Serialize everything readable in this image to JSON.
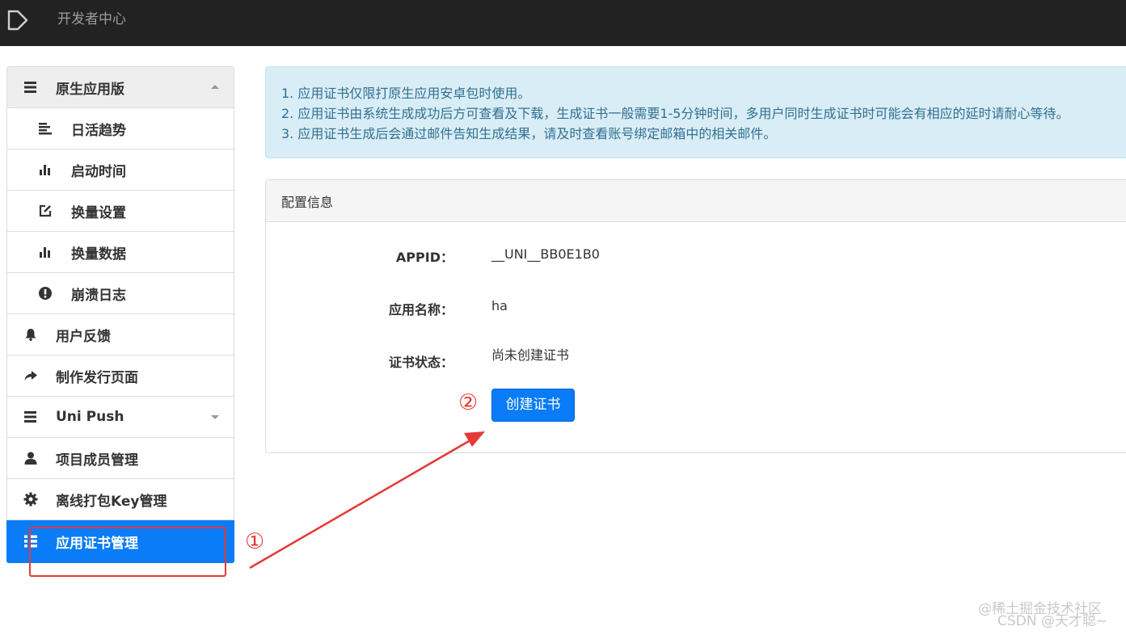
{
  "header": {
    "title": "开发者中心",
    "logo_icon": "play-outline-icon"
  },
  "sidebar": {
    "items": [
      {
        "label": "原生应用版",
        "icon": "menu-icon",
        "caret": "up"
      },
      {
        "label": "日活趋势",
        "icon": "align-left-icon"
      },
      {
        "label": "启动时间",
        "icon": "bar-chart-icon"
      },
      {
        "label": "换量设置",
        "icon": "edit-icon"
      },
      {
        "label": "换量数据",
        "icon": "bar-chart-icon"
      },
      {
        "label": "崩溃日志",
        "icon": "exclamation-circle-icon"
      },
      {
        "label": "用户反馈",
        "icon": "bell-icon"
      },
      {
        "label": "制作发行页面",
        "icon": "share-arrow-icon"
      },
      {
        "label": "Uni Push",
        "icon": "menu-icon",
        "caret": "down"
      },
      {
        "label": "项目成员管理",
        "icon": "user-icon"
      },
      {
        "label": "离线打包Key管理",
        "icon": "gear-icon"
      },
      {
        "label": "应用证书管理",
        "icon": "grid-list-icon"
      }
    ],
    "active_color": "#0a7cf7"
  },
  "alert": {
    "lines": [
      "1. 应用证书仅限打原生应用安卓包时使用。",
      "2. 应用证书由系统生成成功后方可查看及下载，生成证书一般需要1-5分钟时间，多用户同时生成证书时可能会有相应的延时请耐心等待。",
      "3. 应用证书生成后会通过邮件告知生成结果，请及时查看账号绑定邮箱中的相关邮件。"
    ]
  },
  "panel": {
    "title": "配置信息",
    "rows": [
      {
        "label": "APPID：",
        "value": "__UNI__BB0E1B0"
      },
      {
        "label": "应用名称：",
        "value": "ha"
      },
      {
        "label": "证书状态：",
        "value": "尚未创建证书"
      }
    ],
    "button_label": "创建证书"
  },
  "annotations": {
    "marker_1": "①",
    "marker_2": "②",
    "color": "#e53935"
  },
  "watermark": {
    "line1": "@稀土掘金技术社区",
    "line2": "CSDN @天才聪~"
  }
}
